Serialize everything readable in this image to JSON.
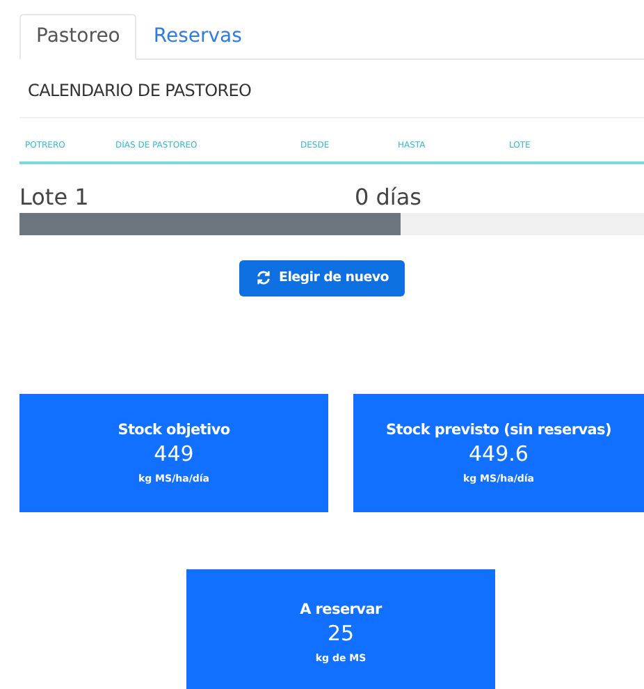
{
  "tabs": [
    {
      "label": "Pastoreo",
      "selected": true
    },
    {
      "label": "Reservas",
      "selected": false
    }
  ],
  "card": {
    "title": "CALENDARIO DE PASTOREO",
    "columns": [
      "POTRERO",
      "DÍAS DE PASTOREO",
      "DESDE",
      "HASTA",
      "LOTE"
    ],
    "lot": {
      "name": "Lote 1",
      "days": "0 días",
      "level": 0.61
    },
    "button": "Elegir de nuevo"
  },
  "stats": [
    {
      "title": "Stock objetivo",
      "value": "449",
      "unit": "kg MS/ha/día"
    },
    {
      "title": "Stock previsto (sin reservas)",
      "value": "449.6",
      "unit": "kg MS/ha/día"
    },
    {
      "title": "A reservar",
      "value": "25",
      "unit": "kg de MS"
    }
  ]
}
